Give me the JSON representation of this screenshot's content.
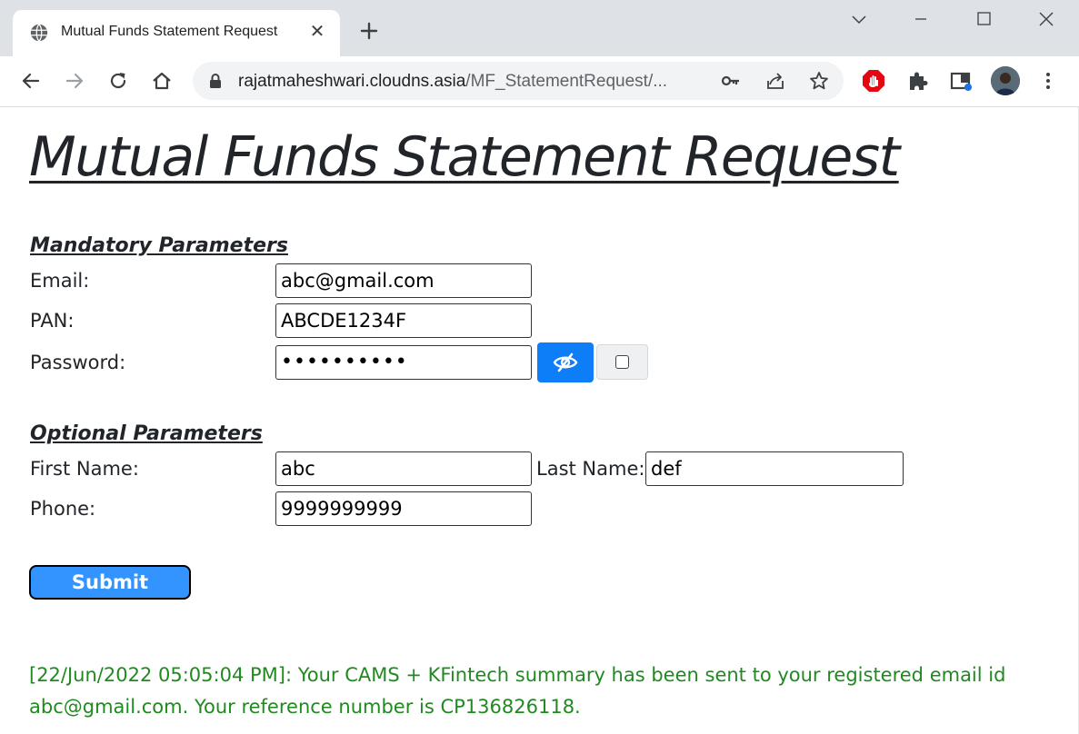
{
  "browser": {
    "tab_title": "Mutual Funds Statement Request",
    "tab_close": "✕",
    "url_domain": "rajatmaheshwari.cloudns.asia",
    "url_path": "/MF_StatementRequest/..."
  },
  "page": {
    "title": "Mutual Funds Statement Request",
    "mandatory_heading": "Mandatory Parameters",
    "optional_heading": "Optional Parameters",
    "labels": {
      "email": "Email:",
      "pan": "PAN:",
      "password": "Password:",
      "first_name": "First Name:",
      "last_name": "Last Name:",
      "phone": "Phone:"
    },
    "values": {
      "email": "abc@gmail.com",
      "pan": "ABCDE1234F",
      "password": "••••••••••",
      "first_name": "abc",
      "last_name": "def",
      "phone": "9999999999"
    },
    "submit_label": "Submit",
    "result_message": "[22/Jun/2022 05:05:04 PM]: Your CAMS + KFintech summary has been sent to your registered email id abc@gmail.com. Your reference number is CP136826118."
  },
  "colors": {
    "accent_blue": "#0d7df8",
    "submit_blue": "#3394ff",
    "success_green": "#208a20"
  },
  "icons": [
    "globe-icon",
    "close-icon",
    "plus-icon",
    "minimize-icon",
    "maximize-icon",
    "chevron-down-icon",
    "back-icon",
    "forward-icon",
    "reload-icon",
    "home-icon",
    "lock-icon",
    "key-icon",
    "share-icon",
    "star-icon",
    "adblock-icon",
    "puzzle-icon",
    "sidepanel-icon",
    "avatar",
    "more-icon",
    "eye-slash-icon"
  ]
}
